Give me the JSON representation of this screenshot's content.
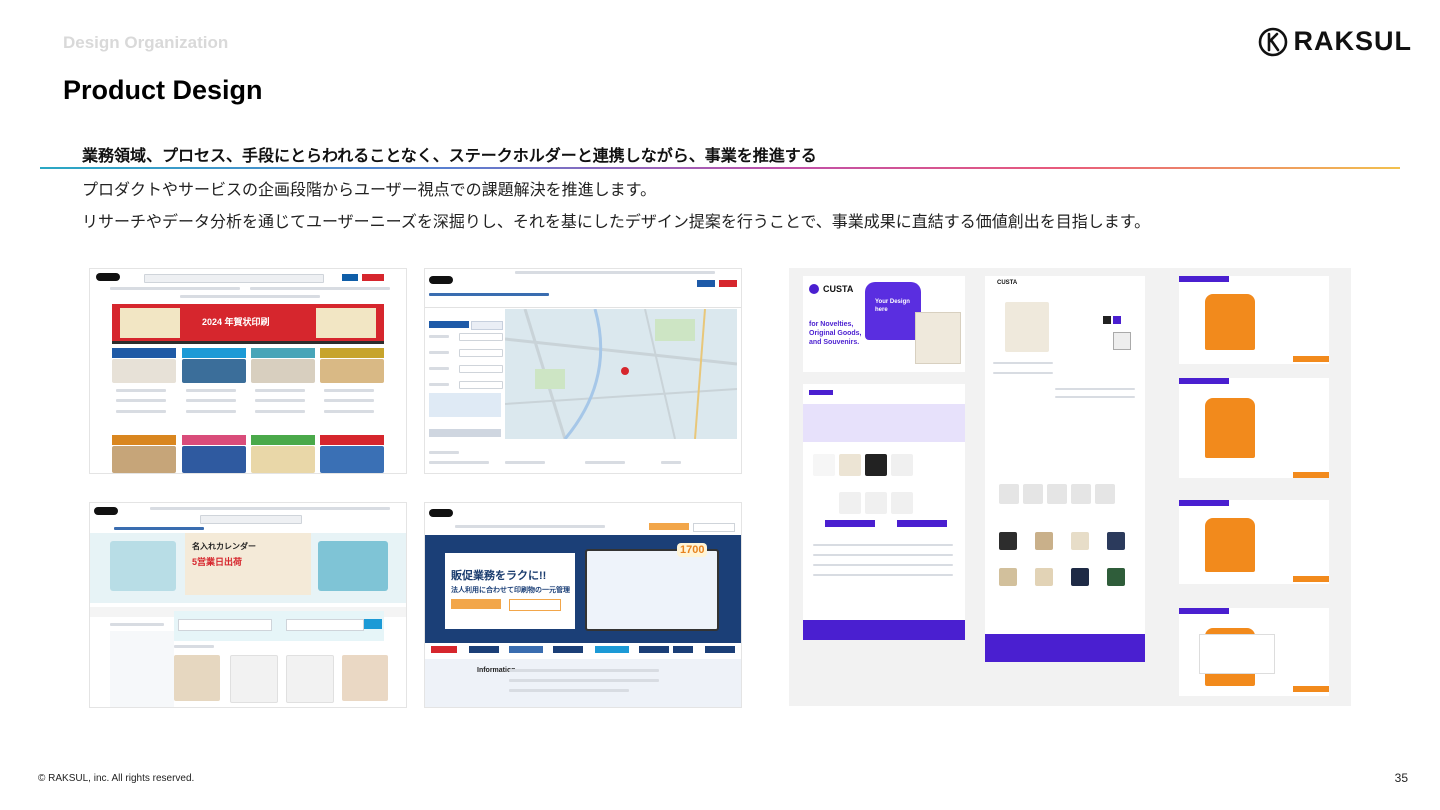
{
  "header": {
    "section_label": "Design Organization",
    "page_title": "Product Design",
    "logo_text": "RAKSUL"
  },
  "content": {
    "headline": "業務領域、プロセス、手段にとらわれることなく、ステークホルダーと連携しながら、事業を推進する",
    "body_line_1": "プロダクトやサービスの企画段階からユーザー視点での課題解決を推進します。",
    "body_line_2": "リサーチやデータ分析を通じてユーザーニーズを深掘りし、それを基にしたデザイン提案を行うことで、事業成果に直結する価値創出を目指します。"
  },
  "screenshots": {
    "raksul_banner": "2024 年賀状印刷",
    "enterprise_headline": "販促業務をラクに!!",
    "enterprise_sub": "法人利用に合わせて印刷物の一元管理",
    "enterprise_badge": "1700",
    "enterprise_info": "Information",
    "calendar_banner": "名入れカレンダー",
    "calendar_delivery": "5営業日出荷",
    "custa_brand": "CUSTA",
    "custa_tagline": "for Novelties, Original Goods, and Souvenirs.",
    "custa_shirt_text": "Your Design here"
  },
  "footer": {
    "copyright": "© RAKSUL, inc. All rights reserved.",
    "page_number": "35"
  },
  "colors": {
    "raksul_blue": "#0f5ea8",
    "raksul_red": "#d6262d",
    "custa_purple": "#4a1fd0",
    "custa_orange": "#f28a1c",
    "enterprise_navy": "#1b3f77"
  }
}
